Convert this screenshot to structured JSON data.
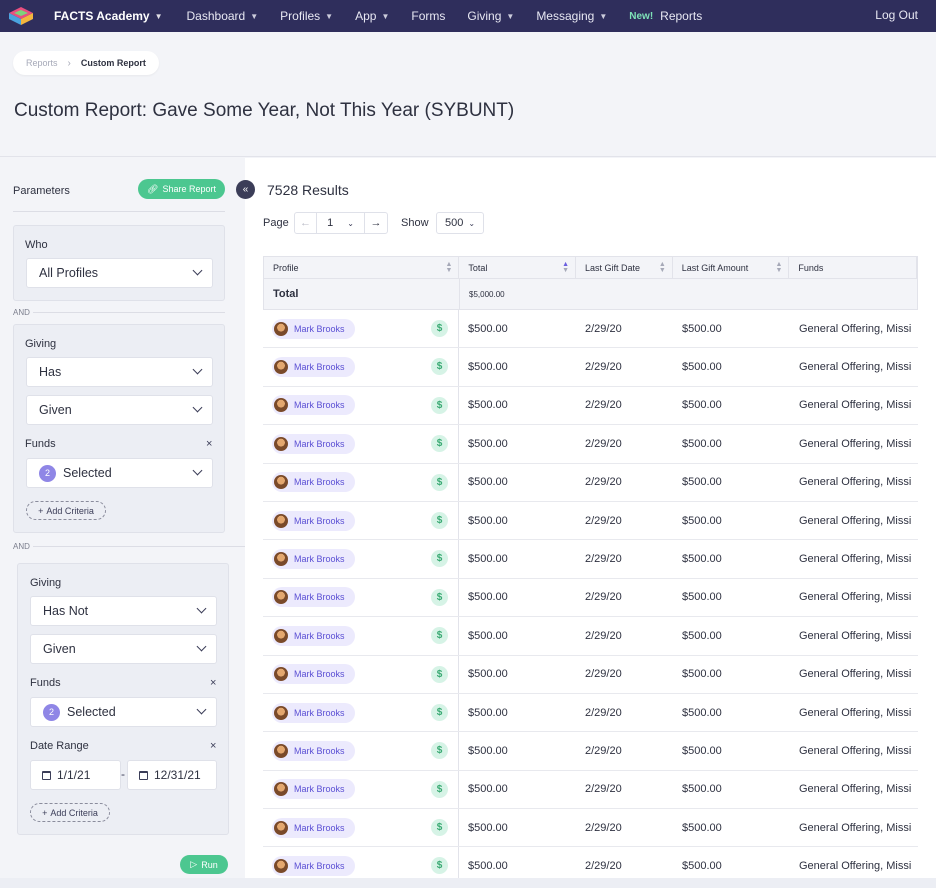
{
  "nav": {
    "brand": "FACTS Academy",
    "items": [
      {
        "label": "Dashboard",
        "caret": true
      },
      {
        "label": "Profiles",
        "caret": true
      },
      {
        "label": "App",
        "caret": true
      },
      {
        "label": "Forms",
        "caret": false
      },
      {
        "label": "Giving",
        "caret": true
      },
      {
        "label": "Messaging",
        "caret": true
      }
    ],
    "new_badge": "New!",
    "reports": "Reports",
    "logout": "Log Out"
  },
  "breadcrumb": {
    "first": "Reports",
    "current": "Custom Report"
  },
  "page_title": "Custom Report: Gave Some Year, Not This Year (SYBUNT)",
  "params": {
    "label": "Parameters",
    "share": "Share Report",
    "who": {
      "label": "Who",
      "value": "All Profiles"
    },
    "and": "AND",
    "group1": {
      "label": "Giving",
      "has": "Has",
      "given": "Given",
      "funds_label": "Funds",
      "funds_count": "2",
      "funds_value": "Selected",
      "add_criteria": "Add Criteria"
    },
    "group2": {
      "label": "Giving",
      "has": "Has Not",
      "given": "Given",
      "funds_label": "Funds",
      "funds_count": "2",
      "funds_value": "Selected",
      "date_label": "Date Range",
      "date_from": "1/1/21",
      "date_to": "12/31/21",
      "add_criteria": "Add Criteria"
    },
    "run": "Run"
  },
  "results": {
    "title": "7528 Results",
    "page_label": "Page",
    "page": "1",
    "show_label": "Show",
    "show_value": "500"
  },
  "table": {
    "columns": [
      "Profile",
      "Total",
      "Last Gift Date",
      "Last Gift Amount",
      "Funds"
    ],
    "total_label": "Total",
    "total_value": "$5,000.00",
    "rows": [
      {
        "name": "Mark Brooks",
        "total": "$500.00",
        "date": "2/29/20",
        "amount": "$500.00",
        "funds": "General Offering, Missi"
      },
      {
        "name": "Mark Brooks",
        "total": "$500.00",
        "date": "2/29/20",
        "amount": "$500.00",
        "funds": "General Offering, Missi"
      },
      {
        "name": "Mark Brooks",
        "total": "$500.00",
        "date": "2/29/20",
        "amount": "$500.00",
        "funds": "General Offering, Missi"
      },
      {
        "name": "Mark Brooks",
        "total": "$500.00",
        "date": "2/29/20",
        "amount": "$500.00",
        "funds": "General Offering, Missi"
      },
      {
        "name": "Mark Brooks",
        "total": "$500.00",
        "date": "2/29/20",
        "amount": "$500.00",
        "funds": "General Offering, Missi"
      },
      {
        "name": "Mark Brooks",
        "total": "$500.00",
        "date": "2/29/20",
        "amount": "$500.00",
        "funds": "General Offering, Missi"
      },
      {
        "name": "Mark Brooks",
        "total": "$500.00",
        "date": "2/29/20",
        "amount": "$500.00",
        "funds": "General Offering, Missi"
      },
      {
        "name": "Mark Brooks",
        "total": "$500.00",
        "date": "2/29/20",
        "amount": "$500.00",
        "funds": "General Offering, Missi"
      },
      {
        "name": "Mark Brooks",
        "total": "$500.00",
        "date": "2/29/20",
        "amount": "$500.00",
        "funds": "General Offering, Missi"
      },
      {
        "name": "Mark Brooks",
        "total": "$500.00",
        "date": "2/29/20",
        "amount": "$500.00",
        "funds": "General Offering, Missi"
      },
      {
        "name": "Mark Brooks",
        "total": "$500.00",
        "date": "2/29/20",
        "amount": "$500.00",
        "funds": "General Offering, Missi"
      },
      {
        "name": "Mark Brooks",
        "total": "$500.00",
        "date": "2/29/20",
        "amount": "$500.00",
        "funds": "General Offering, Missi"
      },
      {
        "name": "Mark Brooks",
        "total": "$500.00",
        "date": "2/29/20",
        "amount": "$500.00",
        "funds": "General Offering, Missi"
      },
      {
        "name": "Mark Brooks",
        "total": "$500.00",
        "date": "2/29/20",
        "amount": "$500.00",
        "funds": "General Offering, Missi"
      },
      {
        "name": "Mark Brooks",
        "total": "$500.00",
        "date": "2/29/20",
        "amount": "$500.00",
        "funds": "General Offering, Missi"
      }
    ]
  }
}
